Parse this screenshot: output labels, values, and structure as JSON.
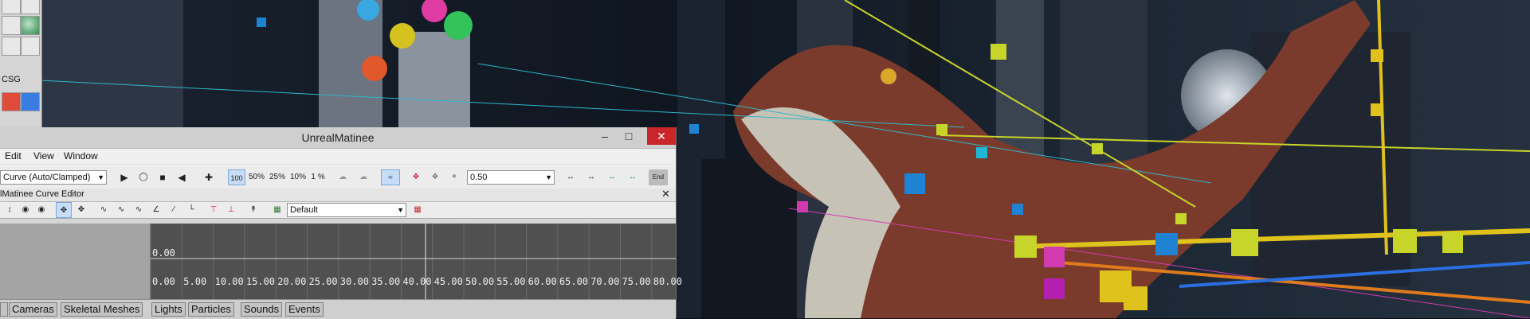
{
  "window": {
    "title": "UnrealMatinee",
    "controls": {
      "minimize": "–",
      "maximize": "□",
      "close": "✕"
    }
  },
  "sidebar": {
    "csg_label": "CSG"
  },
  "menu": {
    "items": [
      "Edit",
      "View",
      "Window"
    ]
  },
  "toolbar": {
    "interp_mode": "Curve (Auto/Clamped)",
    "speeds": [
      "100",
      "50%",
      "25%",
      "10%",
      "1 %"
    ],
    "snap_value": "0.50",
    "end_label": "End"
  },
  "curve_editor": {
    "title": "lMatinee Curve Editor",
    "preset": "Default",
    "value_label": "0.00",
    "time_ticks": [
      "0.00",
      "5.00",
      "10.00",
      "15.00",
      "20.00",
      "25.00",
      "30.00",
      "35.00",
      "40.00",
      "45.00",
      "50.00",
      "55.00",
      "60.00",
      "65.00",
      "70.00",
      "75.00",
      "80.00"
    ]
  },
  "tabs": [
    "Cameras",
    "Skeletal Meshes",
    "Lights",
    "Particles",
    "Sounds",
    "Events"
  ],
  "colors": {
    "accent_selected": "#c7dcf5",
    "close_button": "#c8262b",
    "curve_bg": "#505050"
  }
}
